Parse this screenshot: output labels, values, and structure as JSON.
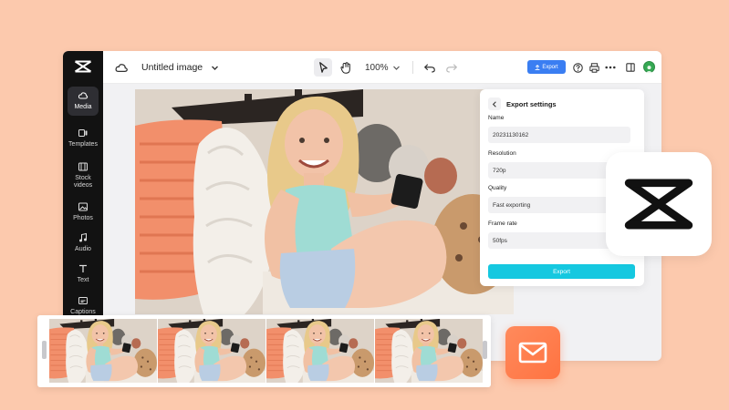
{
  "app": {
    "title": "Untitled image",
    "zoom": "100%",
    "export_label": "Export",
    "accent_color": "#3a7ef2",
    "avatar_color": "#35a853"
  },
  "sidebar": {
    "items": [
      {
        "label": "Media",
        "icon": "media-cloud-icon",
        "active": true
      },
      {
        "label": "Templates",
        "icon": "templates-icon",
        "active": false
      },
      {
        "label": "Stock videos",
        "icon": "film-icon",
        "active": false
      },
      {
        "label": "Photos",
        "icon": "photo-icon",
        "active": false
      },
      {
        "label": "Audio",
        "icon": "music-note-icon",
        "active": false
      },
      {
        "label": "Text",
        "icon": "text-icon",
        "active": false
      },
      {
        "label": "Captions",
        "icon": "captions-icon",
        "active": false
      }
    ]
  },
  "toolbar": {
    "icons": [
      "cloud-icon",
      "chevron-down-icon",
      "pointer-icon",
      "hand-icon",
      "undo-icon",
      "redo-icon",
      "help-icon",
      "print-icon",
      "more-icon",
      "layout-icon"
    ]
  },
  "export_panel": {
    "title": "Export settings",
    "name_label": "Name",
    "name_value": "20231130162",
    "resolution_label": "Resolution",
    "resolution_value": "720p",
    "quality_label": "Quality",
    "quality_value": "Fast exporting",
    "frame_rate_label": "Frame rate",
    "frame_rate_value": "50fps",
    "export_button": "Export",
    "button_color": "#15c8e0"
  },
  "decor": {
    "badge_icon": "capcut-logo-icon",
    "mail_icon": "mail-icon",
    "mail_color": "#ff7a4a"
  }
}
